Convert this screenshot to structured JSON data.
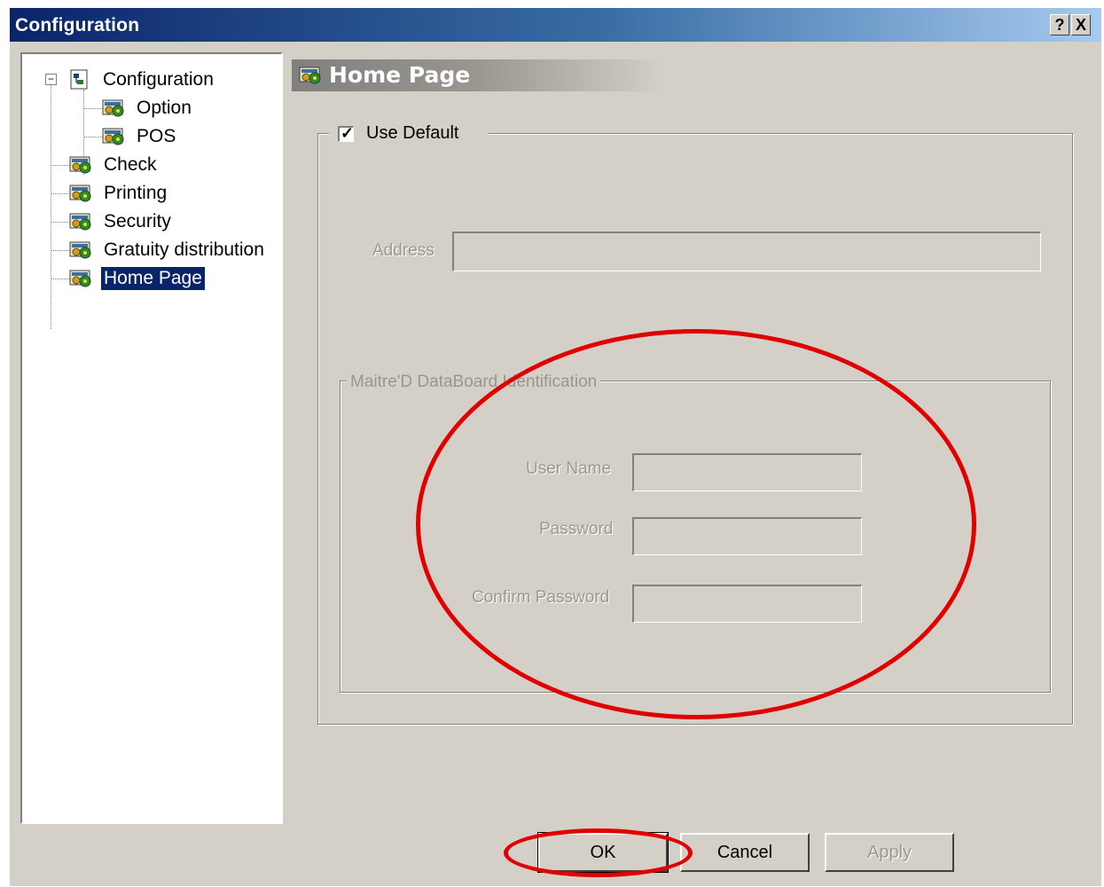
{
  "window": {
    "title": "Configuration",
    "help_label": "?",
    "close_label": "X"
  },
  "tree": {
    "items": [
      {
        "label": "Configuration"
      },
      {
        "label": "Option"
      },
      {
        "label": "POS"
      },
      {
        "label": "Check"
      },
      {
        "label": "Printing"
      },
      {
        "label": "Security"
      },
      {
        "label": "Gratuity distribution"
      },
      {
        "label": "Home Page"
      }
    ],
    "expander": "−"
  },
  "page": {
    "title": "Home Page",
    "use_default": {
      "label": "Use Default",
      "checked": true,
      "mark": "✓"
    },
    "address": {
      "label": "Address",
      "value": ""
    },
    "identification": {
      "legend": "Maitre'D DataBoard Identification",
      "user_name": {
        "label": "User Name",
        "value": ""
      },
      "password": {
        "label": "Password",
        "value": ""
      },
      "confirm_password": {
        "label": "Confirm Password",
        "value": ""
      }
    }
  },
  "buttons": {
    "ok": "OK",
    "cancel": "Cancel",
    "apply": "Apply"
  },
  "colors": {
    "annotation": "#e00000",
    "selection": "#0a246a",
    "dialog_bg": "#d4d0c8"
  }
}
